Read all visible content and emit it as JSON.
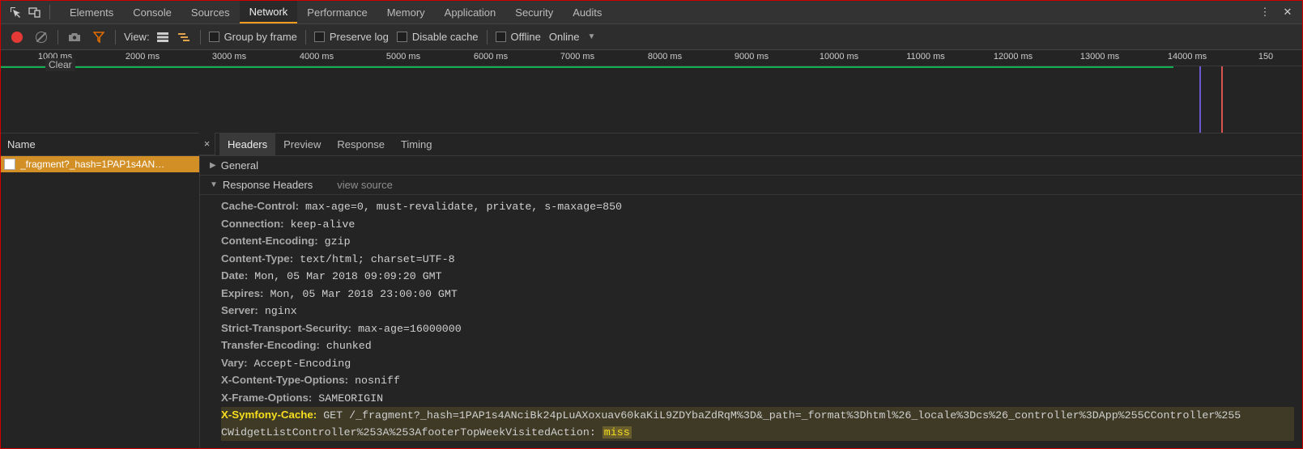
{
  "topTabs": {
    "items": [
      "Elements",
      "Console",
      "Sources",
      "Network",
      "Performance",
      "Memory",
      "Application",
      "Security",
      "Audits"
    ],
    "activeIndex": 3
  },
  "toolbar": {
    "tooltipClear": "Clear",
    "view_label": "View:",
    "group_by_frame": "Group by frame",
    "preserve_log": "Preserve log",
    "disable_cache": "Disable cache",
    "offline": "Offline",
    "online": "Online"
  },
  "timeline": {
    "ticks": [
      "1000 ms",
      "2000 ms",
      "3000 ms",
      "4000 ms",
      "5000 ms",
      "6000 ms",
      "7000 ms",
      "8000 ms",
      "9000 ms",
      "10000 ms",
      "11000 ms",
      "12000 ms",
      "13000 ms",
      "14000 ms",
      "150"
    ],
    "greenEndPx": 1448,
    "purpleMarkerPx": 1480,
    "redMarkerPx": 1507
  },
  "leftPane": {
    "header": "Name",
    "request": "_fragment?_hash=1PAP1s4AN…"
  },
  "detailTabs": [
    "Headers",
    "Preview",
    "Response",
    "Timing"
  ],
  "detailActiveIndex": 0,
  "sections": {
    "general": "General",
    "responseHeaders": "Response Headers",
    "viewSource": "view source"
  },
  "respHeaders": [
    {
      "n": "Cache-Control",
      "v": "max-age=0, must-revalidate, private, s-maxage=850"
    },
    {
      "n": "Connection",
      "v": "keep-alive"
    },
    {
      "n": "Content-Encoding",
      "v": "gzip"
    },
    {
      "n": "Content-Type",
      "v": "text/html; charset=UTF-8"
    },
    {
      "n": "Date",
      "v": "Mon, 05 Mar 2018 09:09:20 GMT"
    },
    {
      "n": "Expires",
      "v": "Mon, 05 Mar 2018 23:00:00 GMT"
    },
    {
      "n": "Server",
      "v": "nginx"
    },
    {
      "n": "Strict-Transport-Security",
      "v": "max-age=16000000"
    },
    {
      "n": "Transfer-Encoding",
      "v": "chunked"
    },
    {
      "n": "Vary",
      "v": "Accept-Encoding"
    },
    {
      "n": "X-Content-Type-Options",
      "v": "nosniff"
    },
    {
      "n": "X-Frame-Options",
      "v": "SAMEORIGIN"
    }
  ],
  "highlightHeader": {
    "n": "X-Symfony-Cache",
    "v1": "GET /_fragment?_hash=1PAP1s4ANciBk24pLuAXoxuav60kaKiL9ZDYbaZdRqM%3D&_path=_format%3Dhtml%26_locale%3Dcs%26_controller%3DApp%255CController%255",
    "v2a": "CWidgetListController%253A%253AfooterTopWeekVisitedAction: ",
    "v2b": "miss"
  }
}
